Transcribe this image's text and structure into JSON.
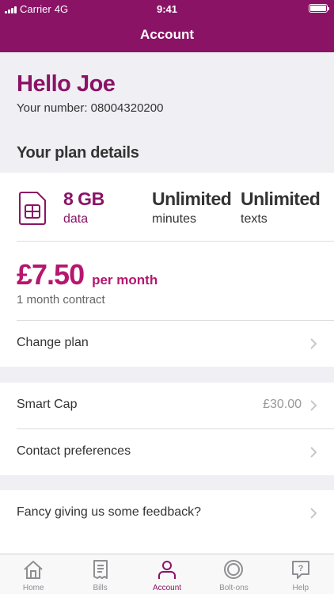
{
  "status": {
    "carrier": "Carrier",
    "network": "4G",
    "time": "9:41"
  },
  "nav": {
    "title": "Account"
  },
  "greeting": {
    "hello": "Hello Joe",
    "number": "Your number: 08004320200"
  },
  "plan": {
    "section_title": "Your plan details",
    "data_amount": "8 GB",
    "data_label": "data",
    "minutes_amount": "Unlimited",
    "minutes_label": "minutes",
    "texts_amount": "Unlimited",
    "texts_label": "texts",
    "price": "£7.50",
    "price_period": "per month",
    "contract": "1 month contract",
    "change_plan": "Change plan"
  },
  "settings": {
    "smart_cap_label": "Smart Cap",
    "smart_cap_value": "£30.00",
    "contact_prefs": "Contact preferences",
    "feedback": "Fancy giving us some feedback?"
  },
  "tabs": [
    {
      "label": "Home",
      "icon": "home-icon"
    },
    {
      "label": "Bills",
      "icon": "bills-icon"
    },
    {
      "label": "Account",
      "icon": "account-icon"
    },
    {
      "label": "Bolt-ons",
      "icon": "bolt-ons-icon"
    },
    {
      "label": "Help",
      "icon": "help-icon"
    }
  ],
  "active_tab": "Account",
  "colors": {
    "brand": "#8a1366",
    "price": "#b5176f",
    "inactive": "#8e8e93"
  }
}
